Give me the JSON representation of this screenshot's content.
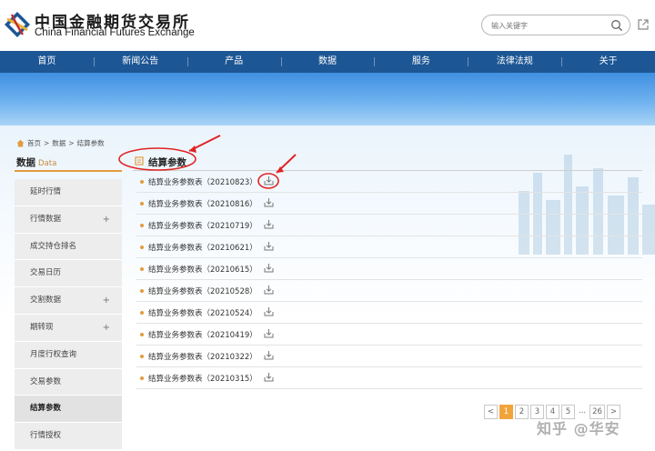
{
  "header": {
    "logo_cn": "中国金融期货交易所",
    "logo_en": "China Financial Futures Exchange",
    "search_placeholder": "输入关键字"
  },
  "nav": {
    "items": [
      "首页",
      "新闻公告",
      "产品",
      "数据",
      "服务",
      "法律法规",
      "关于"
    ]
  },
  "breadcrumb": {
    "items": [
      "首页",
      ">",
      "数据",
      ">",
      "结算参数"
    ]
  },
  "sidebar": {
    "title": "数据",
    "title_en": "Data",
    "items": [
      {
        "label": "延时行情",
        "expandable": ""
      },
      {
        "label": "行情数据",
        "expandable": "+"
      },
      {
        "label": "成交持仓排名",
        "expandable": ""
      },
      {
        "label": "交易日历",
        "expandable": ""
      },
      {
        "label": "交割数据",
        "expandable": "+"
      },
      {
        "label": "期转现",
        "expandable": "+"
      },
      {
        "label": "月度行权查询",
        "expandable": ""
      },
      {
        "label": "交易参数",
        "expandable": ""
      },
      {
        "label": "结算参数",
        "expandable": ""
      },
      {
        "label": "行情授权",
        "expandable": ""
      }
    ]
  },
  "main": {
    "title": "结算参数",
    "rows": [
      "结算业务参数表（20210823）",
      "结算业务参数表（20210816）",
      "结算业务参数表（20210719）",
      "结算业务参数表（20210621）",
      "结算业务参数表（20210615）",
      "结算业务参数表（20210528）",
      "结算业务参数表（20210524）",
      "结算业务参数表（20210419）",
      "结算业务参数表（20210322）",
      "结算业务参数表（20210315）"
    ]
  },
  "pager": {
    "prev": "<",
    "pages": [
      "1",
      "2",
      "3",
      "4",
      "5"
    ],
    "dots": "...",
    "last": "26",
    "next": ">",
    "current": "1"
  },
  "watermark": "知乎 @华安",
  "colors": {
    "nav_bg": "#1d5694",
    "accent": "#e39b3e",
    "annotation_red": "#e02424"
  }
}
